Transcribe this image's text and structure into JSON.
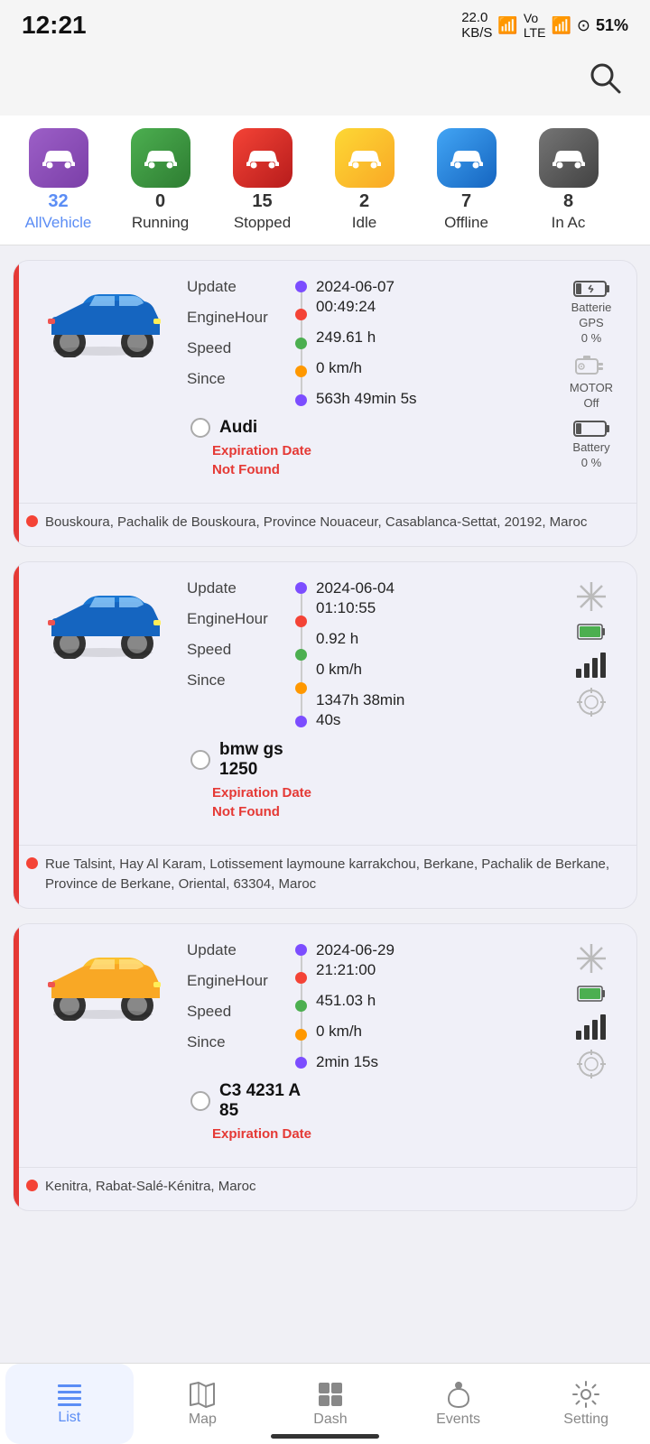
{
  "statusBar": {
    "time": "12:21",
    "battery": "51%",
    "signal": "22.0 KB/S"
  },
  "filterTabs": [
    {
      "id": "all",
      "count": "32",
      "label": "AllVehicle",
      "color": "#9c5fc7",
      "active": true
    },
    {
      "id": "running",
      "count": "0",
      "label": "Running",
      "color": "#4caf50",
      "active": false
    },
    {
      "id": "stopped",
      "count": "15",
      "label": "Stopped",
      "color": "#f44336",
      "active": false
    },
    {
      "id": "idle",
      "count": "2",
      "label": "Idle",
      "color": "#fdd835",
      "active": false
    },
    {
      "id": "offline",
      "count": "7",
      "label": "Offline",
      "color": "#42a5f5",
      "active": false
    },
    {
      "id": "inac",
      "count": "8",
      "label": "In Ac",
      "color": "#757575",
      "active": false
    }
  ],
  "vehicles": [
    {
      "name": "Audi",
      "nameMultiline": false,
      "carColor": "blue",
      "updateDate": "2024-06-07",
      "updateTime": "00:49:24",
      "engineHour": "249.61 h",
      "speed": "0 km/h",
      "since": "563h 49min 5s",
      "expiry": "Expiration Date\nNot Found",
      "batteryLabel": "Batterie",
      "batteryValue": "0 %",
      "gpsLabel": "GPS",
      "motorLabel": "MOTOR",
      "motorValue": "Off",
      "batteryPct": "Battery\n0 %",
      "location": "Bouskoura, Pachalik de Bouskoura, Province Nouaceur, Casablanca-Settat, 20192, Maroc",
      "rightIcons": [
        "battery",
        "gps",
        "motor",
        "battery2"
      ]
    },
    {
      "name": "bmw gs\n1250",
      "nameMultiline": true,
      "carColor": "blue",
      "updateDate": "2024-06-04",
      "updateTime": "01:10:55",
      "engineHour": "0.92 h",
      "speed": "0 km/h",
      "since": "1347h 38min\n40s",
      "expiry": "Expiration Date\nNot Found",
      "location": "Rue Talsint, Hay Al Karam, Lotissement laymoune karrakchou, Berkane, Pachalik de Berkane, Province de Berkane, Oriental, 63304, Maroc",
      "rightIcons": [
        "snowflake",
        "battery-green",
        "signal",
        "target"
      ]
    },
    {
      "name": "C3 4231 A\n85",
      "nameMultiline": true,
      "carColor": "yellow",
      "updateDate": "2024-06-29",
      "updateTime": "21:21:00",
      "engineHour": "451.03 h",
      "speed": "0 km/h",
      "since": "2min 15s",
      "expiry": "Expiration Date",
      "location": "Kenitra, Rabat-Salé-Kénitra, Maroc",
      "rightIcons": [
        "snowflake",
        "battery-green",
        "signal",
        "target"
      ]
    }
  ],
  "bottomNav": [
    {
      "id": "list",
      "label": "List",
      "active": true
    },
    {
      "id": "map",
      "label": "Map",
      "active": false
    },
    {
      "id": "dash",
      "label": "Dash",
      "active": false
    },
    {
      "id": "events",
      "label": "Events",
      "active": false
    },
    {
      "id": "setting",
      "label": "Setting",
      "active": false
    }
  ]
}
